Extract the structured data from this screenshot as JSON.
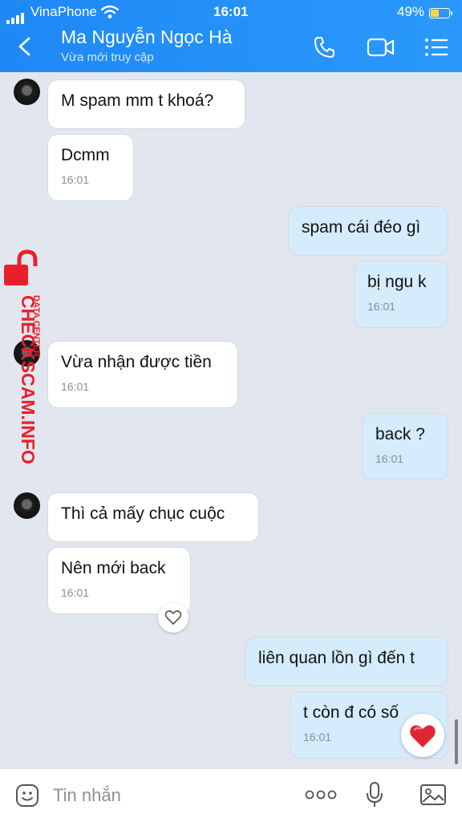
{
  "status_bar": {
    "carrier": "VinaPhone",
    "time": "16:01",
    "battery": "49%",
    "battery_level": 0.49
  },
  "header": {
    "contact_name": "Ma Nguyễn Ngọc Hà",
    "status": "Vừa mới truy cập"
  },
  "messages": [
    {
      "text": "M spam mm t khoá?",
      "time": ""
    },
    {
      "text": "Dcmm",
      "time": "16:01"
    },
    {
      "text": "spam cái đéo gì",
      "time": ""
    },
    {
      "text": "bị ngu k",
      "time": "16:01"
    },
    {
      "text": "Vừa nhận được tiền",
      "time": "16:01"
    },
    {
      "text": "back ?",
      "time": "16:01"
    },
    {
      "text": "Thì cả mấy chục cuộc",
      "time": ""
    },
    {
      "text": "Nên mới back",
      "time": "16:01"
    },
    {
      "text": "liên quan lồn gì đến t",
      "time": ""
    },
    {
      "text": "t còn đ có số",
      "time": "16:01"
    }
  ],
  "watermark": {
    "brand": "CHECKSCAM.INFO",
    "sub": "DATA CENTER"
  },
  "input": {
    "placeholder": "Tin nhắn"
  },
  "colors": {
    "header": "#1e88f5",
    "outgoing_bubble": "#d4ecfc",
    "incoming_bubble": "#ffffff",
    "background": "#e2e7ef",
    "watermark": "#e8202a"
  }
}
